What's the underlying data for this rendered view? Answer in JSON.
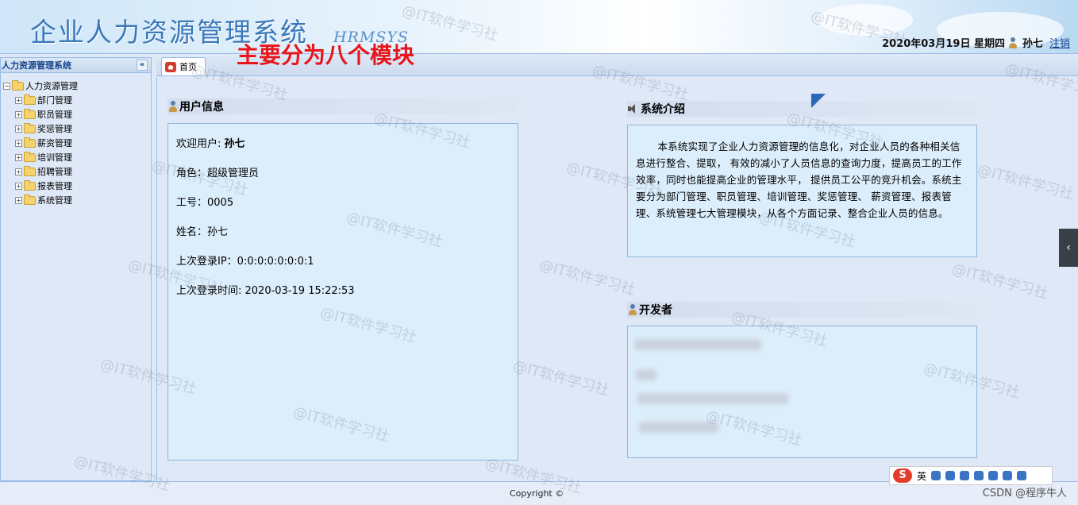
{
  "header": {
    "title": "企业人力资源管理系统",
    "subtitle": "HRMSYS",
    "annotation": "主要分为八个模块",
    "date": "2020年03月19日 星期四",
    "user": "孙七",
    "logout": "注销"
  },
  "sidebar": {
    "title": "人力资源管理系统",
    "collapse_glyph": "«",
    "root": "人力资源管理",
    "items": [
      "部门管理",
      "职员管理",
      "奖惩管理",
      "薪资管理",
      "培训管理",
      "招聘管理",
      "报表管理",
      "系统管理"
    ]
  },
  "tabs": [
    {
      "label": "首页"
    }
  ],
  "user_info": {
    "heading": "用户信息",
    "welcome_label": "欢迎用户: ",
    "welcome_name": "孙七",
    "role": "角色：超级管理员",
    "employee_id": "工号：0005",
    "name": "姓名：孙七",
    "last_ip": "上次登录IP：0:0:0:0:0:0:0:1",
    "last_login": "上次登录时间: 2020-03-19 15:22:53"
  },
  "intro": {
    "heading": "系统介绍",
    "text": "本系统实现了企业人力资源管理的信息化，对企业人员的各种相关信息进行整合、提取， 有效的减小了人员信息的查询力度，提高员工的工作效率，同时也能提高企业的管理水平， 提供员工公平的竞升机会。系统主要分为部门管理、职员管理、培训管理、奖惩管理、 薪资管理、报表管理、系统管理七大管理模块，从各个方面记录、整合企业人员的信息。"
  },
  "developer": {
    "heading": "开发者"
  },
  "footer": {
    "copyright": "Copyright ©",
    "ime_label": "英",
    "csdn": "CSDN @程序牛人"
  },
  "watermark": "@IT软件学习社",
  "side_arrow": "‹",
  "colors": {
    "accent": "#15428b",
    "annotation": "#e8151b",
    "border": "#99bbe8"
  }
}
